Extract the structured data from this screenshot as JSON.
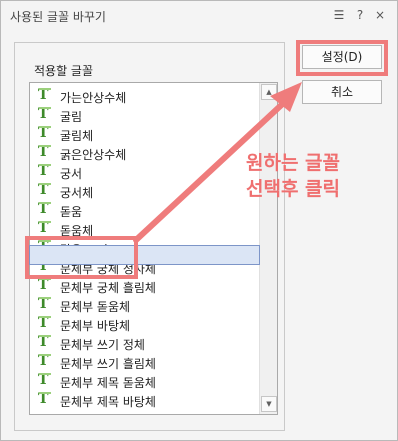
{
  "title": "사용된 글꼴 바꾸기",
  "titlebar_icons": [
    {
      "name": "window-menu-icon",
      "glyph": "☰"
    },
    {
      "name": "help-icon",
      "glyph": "?"
    },
    {
      "name": "close-icon",
      "glyph": "×"
    }
  ],
  "list_label": "적용할 글꼴",
  "fonts": [
    "가는안상수체",
    "굴림",
    "굴림체",
    "굵은안상수체",
    "궁서",
    "궁서체",
    "돋움",
    "돋움체",
    "맑은 고딕",
    "문체부 궁체 정자체",
    "문체부 궁체 흘림체",
    "문체부 돋움체",
    "문체부 바탕체",
    "문체부 쓰기 정체",
    "문체부 쓰기 흘림체",
    "문체부 제목 돋움체",
    "문체부 제목 바탕체"
  ],
  "selected_font": "맑은 고딕",
  "font_icon_glyph": "T",
  "scroll_up_glyph": "▲",
  "scroll_down_glyph": "▼",
  "buttons": {
    "ok_label": "설정(D)",
    "cancel_label": "취소"
  },
  "annotation": {
    "line1": "원하는 글꼴",
    "line2": "선택후 클릭",
    "color": "#ef7c7c"
  }
}
